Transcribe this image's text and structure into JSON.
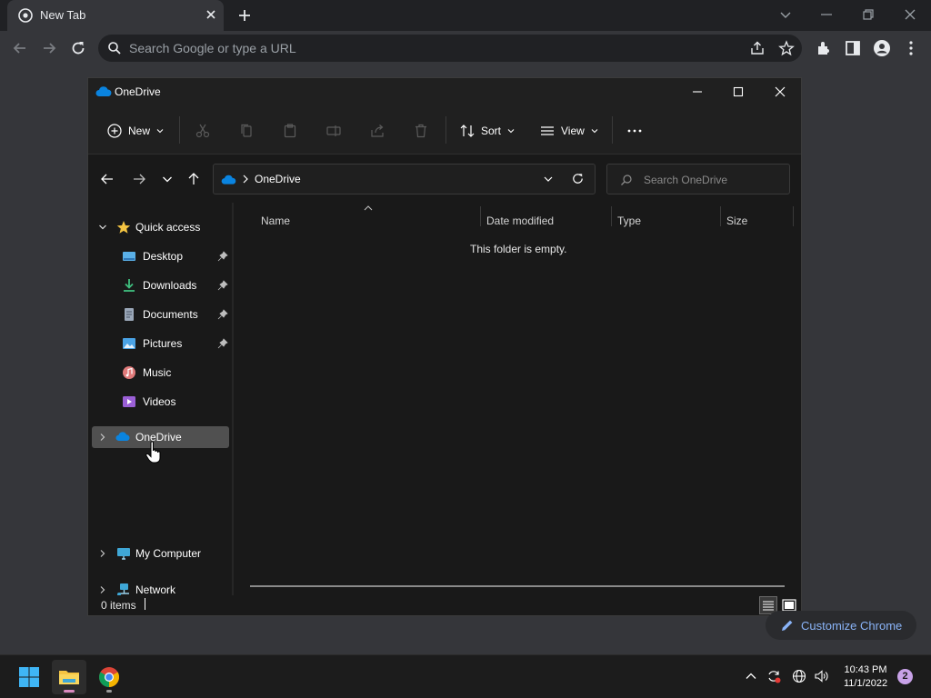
{
  "browser": {
    "tab_title": "New Tab",
    "omnibox_placeholder": "Search Google or type a URL",
    "customize_label": "Customize Chrome"
  },
  "explorer": {
    "window_title": "OneDrive",
    "commands": {
      "new_label": "New",
      "sort_label": "Sort",
      "view_label": "View"
    },
    "address_path": "OneDrive",
    "search_placeholder": "Search OneDrive",
    "sidebar": {
      "quick_access": "Quick access",
      "pinned": [
        {
          "label": "Desktop",
          "icon": "desktop-icon"
        },
        {
          "label": "Downloads",
          "icon": "downloads-icon"
        },
        {
          "label": "Documents",
          "icon": "documents-icon"
        },
        {
          "label": "Pictures",
          "icon": "pictures-icon"
        },
        {
          "label": "Music",
          "icon": "music-icon"
        },
        {
          "label": "Videos",
          "icon": "videos-icon"
        }
      ],
      "onedrive": "OneDrive",
      "my_computer": "My Computer",
      "network": "Network"
    },
    "columns": [
      "Name",
      "Date modified",
      "Type",
      "Size"
    ],
    "empty_message": "This folder is empty.",
    "status": "0 items"
  },
  "taskbar": {
    "time": "10:43 PM",
    "date": "11/1/2022",
    "notification_count": "2"
  },
  "colors": {
    "accent_blue": "#8ab4f8",
    "onedrive_blue": "#0a84e0",
    "folder_yellow": "#f5c542",
    "selected_row": "#505050"
  }
}
